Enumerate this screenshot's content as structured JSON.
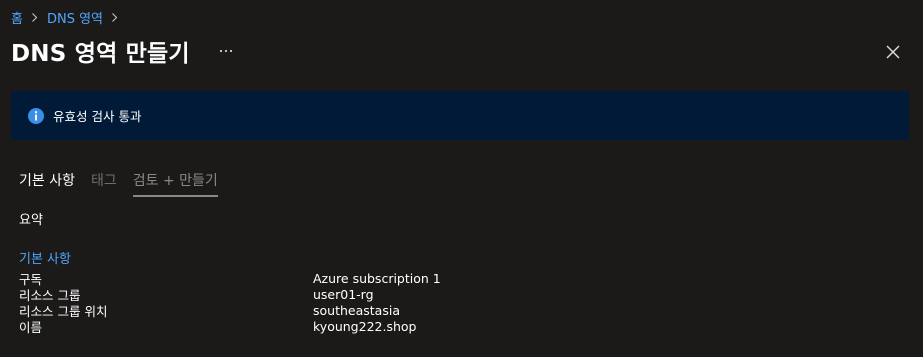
{
  "breadcrumb": {
    "items": [
      {
        "label": "홈"
      },
      {
        "label": "DNS 영역"
      }
    ]
  },
  "page": {
    "title": "DNS 영역 만들기",
    "more_label": "…"
  },
  "banner": {
    "text": "유효성 검사 통과",
    "icon": "info-icon"
  },
  "tabs": [
    {
      "label": "기본 사항"
    },
    {
      "label": "태그"
    },
    {
      "label": "검토 + 만들기"
    }
  ],
  "summary": {
    "heading": "요약",
    "section_heading": "기본 사항",
    "rows": [
      {
        "label": "구독",
        "value": "Azure subscription 1"
      },
      {
        "label": "리소스 그룹",
        "value": "user01-rg"
      },
      {
        "label": "리소스 그룹 위치",
        "value": "southeastasia"
      },
      {
        "label": "이름",
        "value": "kyoung222.shop"
      }
    ]
  },
  "colors": {
    "background": "#1b1a19",
    "link": "#4ea6ff",
    "banner_bg": "#001a38",
    "info_icon": "#3a8ee6"
  }
}
